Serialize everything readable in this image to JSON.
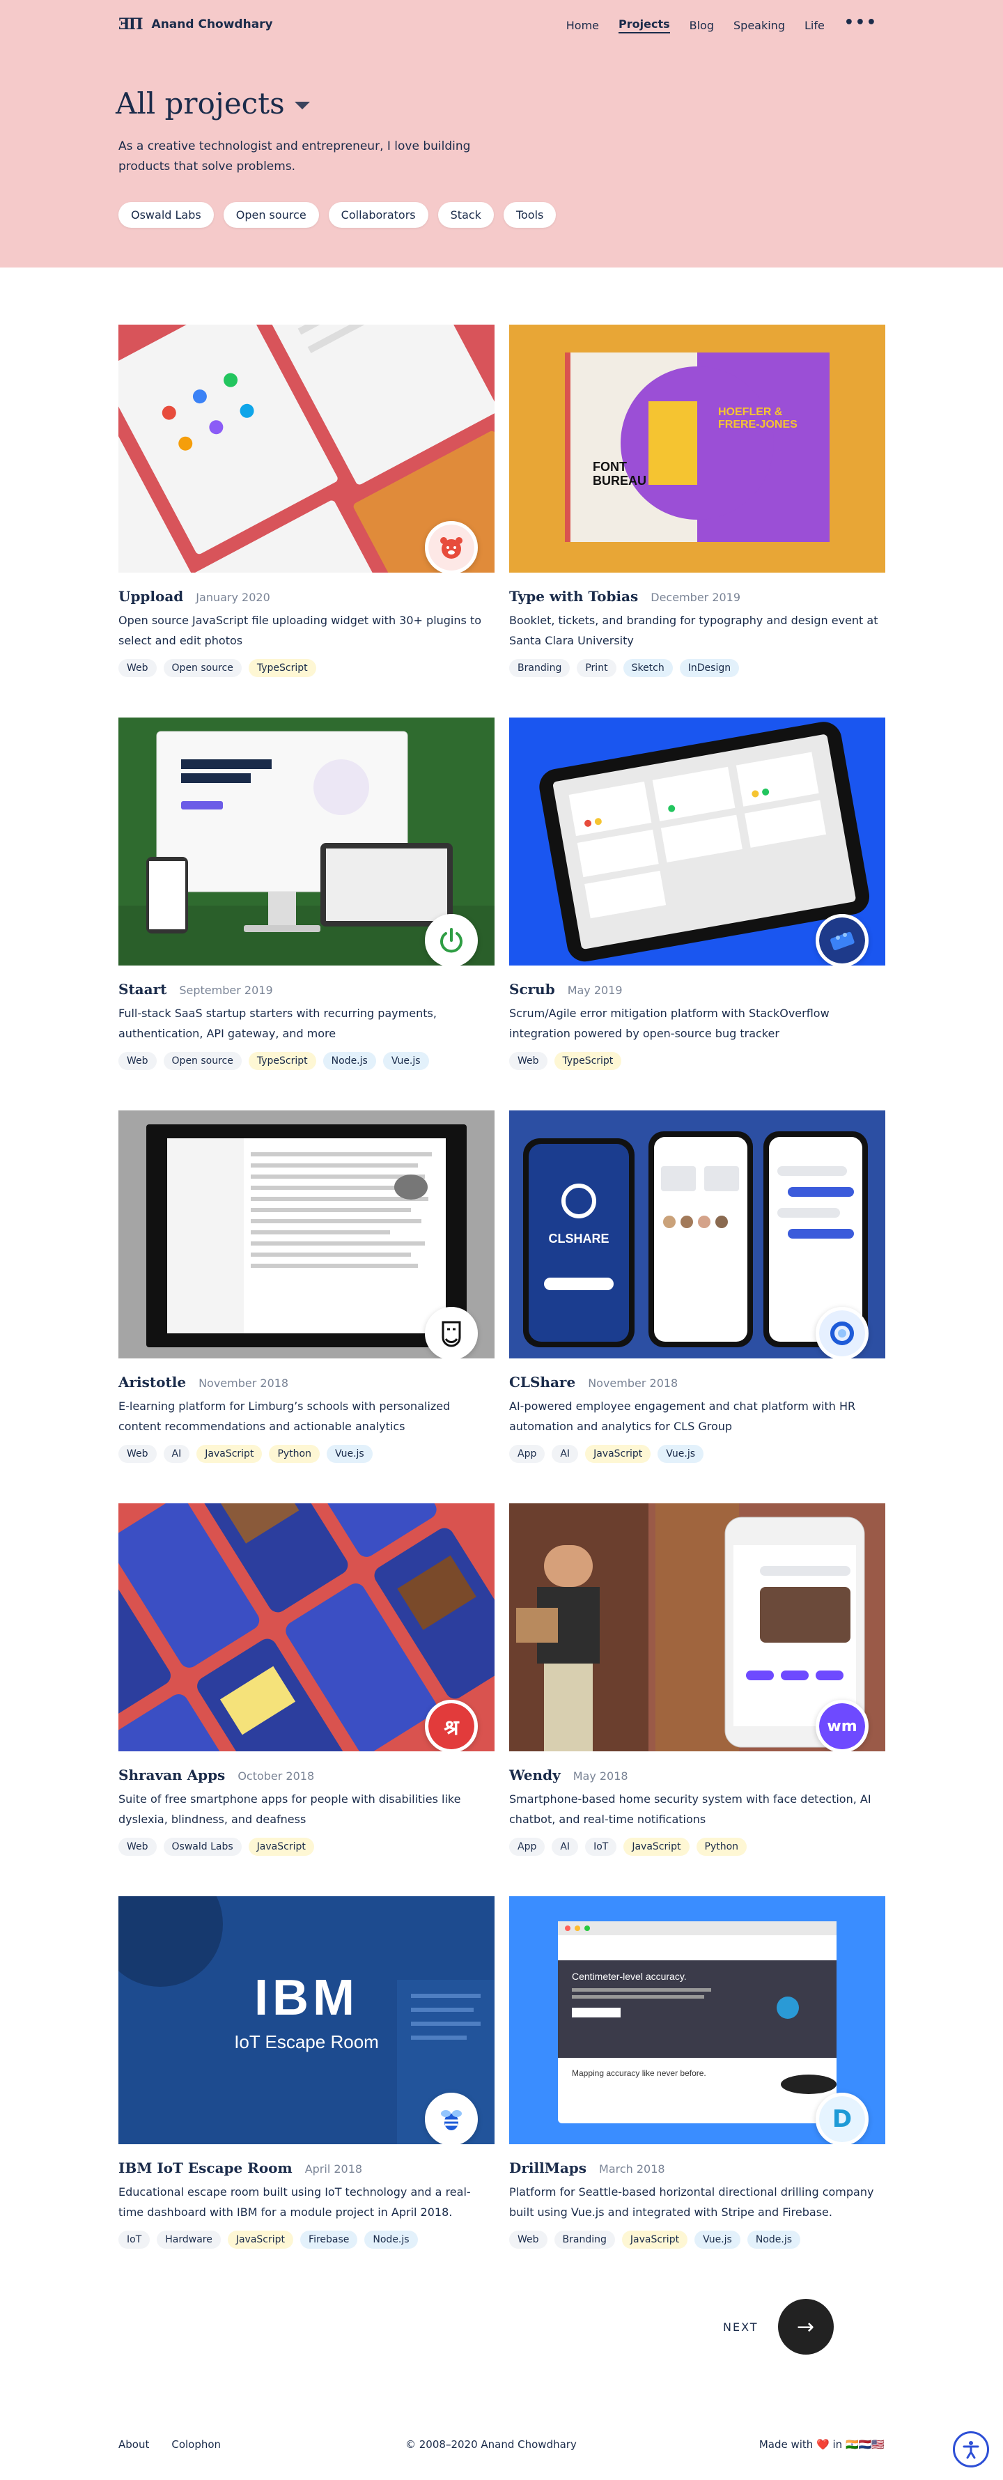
{
  "header": {
    "logo_mark": "ƎΠ",
    "brand": "Anand Chowdhary",
    "nav": [
      "Home",
      "Projects",
      "Blog",
      "Speaking",
      "Life"
    ],
    "more": "•••"
  },
  "hero": {
    "title": "All projects",
    "intro": "As a creative technologist and entrepreneur, I love building products that solve problems.",
    "filters": [
      "Oswald Labs",
      "Open source",
      "Collaborators",
      "Stack",
      "Tools"
    ]
  },
  "projects": [
    {
      "title": "Uppload",
      "date": "January 2020",
      "desc": "Open source JavaScript file uploading widget with 30+ plugins to select and edit photos",
      "tags": [
        "Web",
        "Open source",
        "TypeScript"
      ],
      "badge_icon": "hamster-icon",
      "accent": "#e74c3c"
    },
    {
      "title": "Type with Tobias",
      "date": "December 2019",
      "desc": "Booklet, tickets, and branding for typography and design event at Santa Clara University",
      "tags": [
        "Branding",
        "Print",
        "Sketch",
        "InDesign"
      ],
      "accent": "#e8a636"
    },
    {
      "title": "Staart",
      "date": "September 2019",
      "desc": "Full-stack SaaS startup starters with recurring payments, authentication, API gateway, and more",
      "tags": [
        "Web",
        "Open source",
        "TypeScript",
        "Node.js",
        "Vue.js"
      ],
      "badge_icon": "power-icon",
      "accent": "#2f6b2f"
    },
    {
      "title": "Scrub",
      "date": "May 2019",
      "desc": "Scrum/Agile error mitigation platform with StackOverflow integration powered by open-source bug tracker",
      "tags": [
        "Web",
        "TypeScript"
      ],
      "badge_icon": "brick-icon",
      "accent": "#1a56f0"
    },
    {
      "title": "Aristotle",
      "date": "November 2018",
      "desc": "E-learning platform for Limburg’s schools with personalized content recommendations and actionable analytics",
      "tags": [
        "Web",
        "AI",
        "JavaScript",
        "Python",
        "Vue.js"
      ],
      "badge_icon": "aristotle-face-icon",
      "accent": "#9a9a9a"
    },
    {
      "title": "CLShare",
      "date": "November 2018",
      "desc": "AI-powered employee engagement and chat platform with HR automation and analytics for CLS Group",
      "tags": [
        "App",
        "AI",
        "JavaScript",
        "Vue.js"
      ],
      "badge_icon": "ring-icon",
      "accent": "#2c4fa3"
    },
    {
      "title": "Shravan Apps",
      "date": "October 2018",
      "desc": "Suite of free smartphone apps for people with disabilities like dyslexia, blindness, and deafness",
      "tags": [
        "Web",
        "Oswald Labs",
        "JavaScript"
      ],
      "badge_icon": "devanagari-shra-icon",
      "badge_text": "श्र",
      "accent": "#d93a2e"
    },
    {
      "title": "Wendy",
      "date": "May 2018",
      "desc": "Smartphone-based home security system with face detection, AI chatbot, and real-time notifications",
      "tags": [
        "App",
        "AI",
        "IoT",
        "JavaScript",
        "Python"
      ],
      "badge_icon": "wendy-logo-icon",
      "badge_text": "wm",
      "accent": "#6e4aff"
    },
    {
      "title": "IBM IoT Escape Room",
      "date": "April 2018",
      "desc": "Educational escape room built using IoT technology and a real-time dashboard with IBM for a module project in April 2018.",
      "tags": [
        "IoT",
        "Hardware",
        "JavaScript",
        "Firebase",
        "Node.js"
      ],
      "badge_icon": "bee-icon",
      "thumb_text": [
        "IBM",
        "IoT Escape Room"
      ],
      "accent": "#1d4b8f"
    },
    {
      "title": "DrillMaps",
      "date": "March 2018",
      "desc": "Platform for Seattle-based horizontal directional drilling company built using Vue.js and integrated with Stripe and Firebase.",
      "tags": [
        "Web",
        "Branding",
        "JavaScript",
        "Vue.js",
        "Node.js"
      ],
      "badge_icon": "drillmaps-d-icon",
      "badge_text": "D",
      "thumb_text": [
        "Centimeter-level accuracy.",
        "Mapping accuracy like never before."
      ],
      "accent": "#3a8dff"
    }
  ],
  "pagination": {
    "next_label": "NEXT",
    "arrow": "→"
  },
  "footer": {
    "links": [
      "About",
      "Colophon"
    ],
    "copyright": "© 2008–2020 Anand Chowdhary",
    "made_with": "Made with ❤️ in 🇮🇳🇳🇱🇺🇸"
  },
  "book": {
    "line1": "HOEFLER &",
    "line2": "FRERE-JONES",
    "line3": "FONT",
    "line4": "BUREAU"
  },
  "clshare_brand": "CLSHARE"
}
